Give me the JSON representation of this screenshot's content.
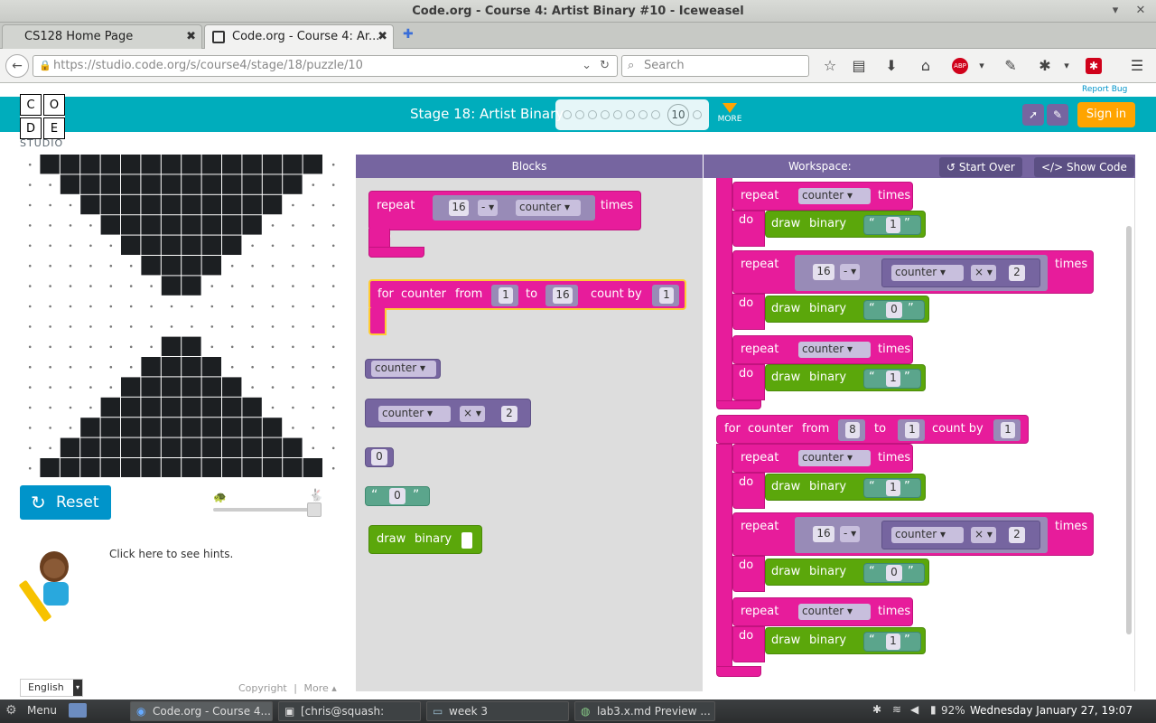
{
  "window": {
    "title": "Code.org - Course 4: Artist Binary #10 - Iceweasel",
    "min": "▾",
    "close": "✕"
  },
  "tabs": [
    {
      "label": "CS128 Home Page",
      "close": "✖"
    },
    {
      "label": "Code.org - Course 4: Ar...",
      "close": "✖"
    }
  ],
  "new_tab": "✚",
  "nav": {
    "url": "https://studio.code.org/s/course4/stage/18/puzzle/10",
    "search_placeholder": "Search"
  },
  "header": {
    "logo_letters": [
      "C",
      "O",
      "D",
      "E"
    ],
    "studio": "STUDIO",
    "stage_title": "Stage 18: Artist Binary",
    "puzzle_number": "10",
    "more": "MORE",
    "sign_in": "Sign in",
    "report_bug": "Report Bug"
  },
  "controls": {
    "reset": "Reset",
    "hint": "Click here to see hints.",
    "language": "English",
    "copyright": "Copyright",
    "more": "More ▴"
  },
  "blockly": {
    "blocks_header": "Blocks",
    "workspace_header": "Workspace:",
    "start_over": "Start Over",
    "show_code": "Show Code"
  },
  "toolbox": {
    "repeat": {
      "repeat": "repeat",
      "num": "16",
      "op": "-",
      "var": "counter",
      "times": "times",
      "do": "do"
    },
    "for": {
      "for": "for",
      "var": "counter",
      "from": "from",
      "from_val": "1",
      "to": "to",
      "to_val": "16",
      "by": "count by",
      "by_val": "1"
    },
    "counter": "counter",
    "mult": {
      "var": "counter",
      "op": "×",
      "num": "2"
    },
    "zero": "0",
    "string": "0",
    "draw": {
      "draw": "draw",
      "binary": "binary"
    }
  },
  "workspace": {
    "repeat": "repeat",
    "times": "times",
    "do": "do",
    "draw": "draw",
    "binary": "binary",
    "counter": "counter",
    "minus": "-",
    "mult": "×",
    "sixteen": "16",
    "two": "2",
    "one": "1",
    "zero": "0",
    "for_label": "for",
    "from": "from",
    "to": "to",
    "count_by": "count by",
    "for_from": "8",
    "for_to": "1",
    "for_by": "1"
  },
  "taskbar": {
    "menu": "Menu",
    "tasks": [
      "Code.org - Course 4...",
      "[chris@squash: ~/Gi...",
      "week 3",
      "lab3.x.md Preview ..."
    ],
    "battery": "92%",
    "clock": "Wednesday January 27, 19:07"
  }
}
